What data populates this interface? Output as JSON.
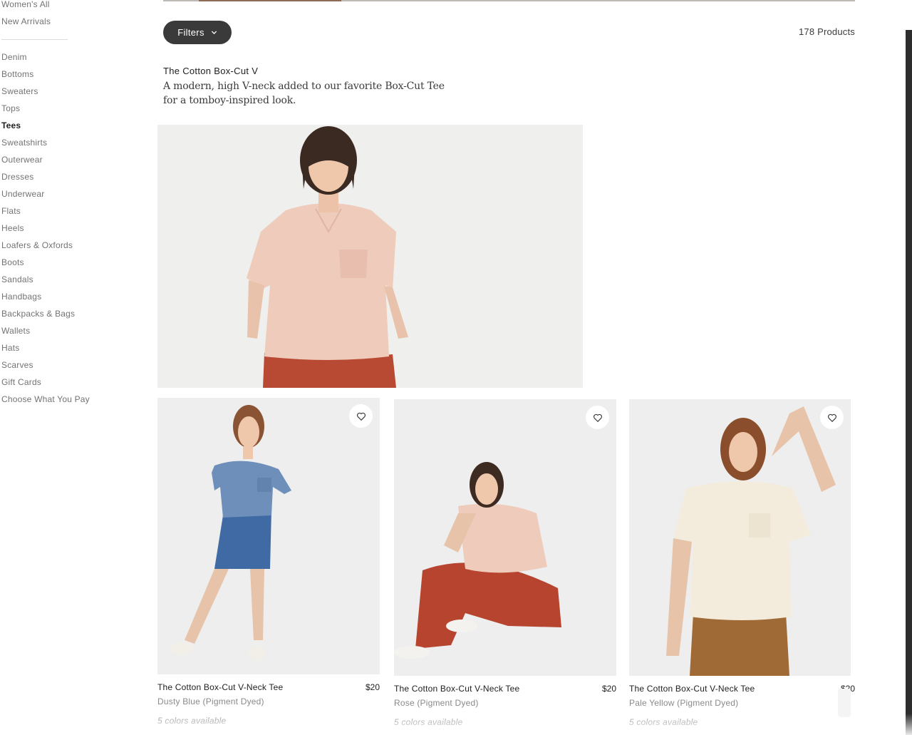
{
  "sidebar": {
    "top_items": [
      {
        "label": "Women's All"
      },
      {
        "label": "New Arrivals"
      }
    ],
    "categories": [
      {
        "label": "Denim"
      },
      {
        "label": "Bottoms"
      },
      {
        "label": "Sweaters"
      },
      {
        "label": "Tops"
      },
      {
        "label": "Tees",
        "active": true
      },
      {
        "label": "Sweatshirts"
      },
      {
        "label": "Outerwear"
      },
      {
        "label": "Dresses"
      },
      {
        "label": "Underwear"
      },
      {
        "label": "Flats"
      },
      {
        "label": "Heels"
      },
      {
        "label": "Loafers & Oxfords"
      },
      {
        "label": "Boots"
      },
      {
        "label": "Sandals"
      },
      {
        "label": "Handbags"
      },
      {
        "label": "Backpacks & Bags"
      },
      {
        "label": "Wallets"
      },
      {
        "label": "Hats"
      },
      {
        "label": "Scarves"
      },
      {
        "label": "Gift Cards"
      },
      {
        "label": "Choose What You Pay"
      }
    ]
  },
  "toolbar": {
    "filters_label": "Filters",
    "products_count": "178 Products"
  },
  "feature": {
    "title": "The Cotton Box-Cut V",
    "description": "A modern, high V-neck added to our favorite Box-Cut Tee for a tomboy-inspired look."
  },
  "products": [
    {
      "name": "The Cotton Box-Cut V-Neck Tee",
      "price": "$20",
      "color": "Dusty Blue (Pigment Dyed)",
      "availability": "5 colors available"
    },
    {
      "name": "The Cotton Box-Cut V-Neck Tee",
      "price": "$20",
      "color": "Rose (Pigment Dyed)",
      "availability": "5 colors available"
    },
    {
      "name": "The Cotton Box-Cut V-Neck Tee",
      "price": "$20",
      "color": "Pale Yellow (Pigment Dyed)",
      "availability": "5 colors available"
    }
  ],
  "icons": {
    "filters": "chevron-down-icon",
    "wishlist": "heart-icon"
  },
  "colors": {
    "filters_button": "#3a3a3a",
    "card_background": "#eeeeee",
    "text_muted": "#8a8a8a"
  }
}
